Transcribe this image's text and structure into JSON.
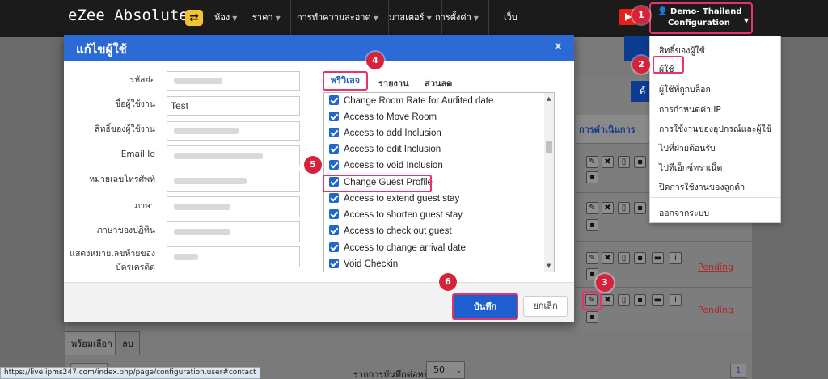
{
  "topbar": {
    "brand": "eZee Absolute",
    "nav": [
      {
        "label": "ห้อง",
        "caret": true
      },
      {
        "label": "ราคา",
        "caret": true
      },
      {
        "label": "การทำความสะอาด",
        "caret": true
      },
      {
        "label": "มาสเตอร์",
        "caret": true
      },
      {
        "label": "การตั้งค่า",
        "caret": true
      },
      {
        "label": "เว็บ",
        "caret": false
      }
    ],
    "user_line1": "Demo- Thailand",
    "user_line2": "Configuration"
  },
  "steps": [
    "1",
    "2",
    "3",
    "4",
    "5",
    "6"
  ],
  "dropdown": {
    "items": [
      "สิทธิ์ของผู้ใช้",
      "ผู้ใช้",
      "ผู้ใช้ที่ถูกบล็อก",
      "การกำหนดค่า IP",
      "การใช้งานของอุปกรณ์และผู้ใช้",
      "ไปที่ฝ่ายต้อนรับ",
      "ไปที่เอ็กซ์ทราเน็ต",
      "ปิดการใช้งานของลูกค้า"
    ],
    "logout": "ออกจากระบบ"
  },
  "background": {
    "actions_header": "การดำเนินการ",
    "blue_button_fragment": "ค้",
    "pending": "Pending",
    "bottom_tabs": {
      "select": "พร้อมเลือก",
      "delete": "ลบ"
    },
    "per_page_label": "รายการบันทึกต่อหน้า",
    "per_page_value": "50",
    "page_number": "1"
  },
  "modal": {
    "title": "แก้ไขผู้ใช้",
    "close": "x",
    "fields": [
      {
        "label": "รหัสย่อ",
        "value": ""
      },
      {
        "label": "ชื่อผู้ใช้งาน",
        "value": "Test"
      },
      {
        "label": "สิทธิ์ของผู้ใช้งาน",
        "value": ""
      },
      {
        "label": "Email Id",
        "value": ""
      },
      {
        "label": "หมายเลขโทรศัพท์",
        "value": ""
      },
      {
        "label": "ภาษา",
        "value": ""
      },
      {
        "label": "ภาษาของปฏิทิน",
        "value": ""
      },
      {
        "label_line1": "แสดงหมายเลขท้ายของ",
        "label_line2": "บัตรเครดิต",
        "value": ""
      }
    ],
    "tabs": [
      "พริวิเลจ",
      "รายงาน",
      "ส่วนลด"
    ],
    "permissions": [
      {
        "label": "Change Room Rate for Audited date",
        "checked": true
      },
      {
        "label": "Access to Move Room",
        "checked": true
      },
      {
        "label": "Access to add Inclusion",
        "checked": true
      },
      {
        "label": "Access to edit Inclusion",
        "checked": true
      },
      {
        "label": "Access to void Inclusion",
        "checked": true
      },
      {
        "label": "Change Guest Profile",
        "checked": true
      },
      {
        "label": "Access to extend guest stay",
        "checked": true
      },
      {
        "label": "Access to shorten guest stay",
        "checked": true
      },
      {
        "label": "Access to check out guest",
        "checked": true
      },
      {
        "label": "Access to change arrival date",
        "checked": true
      },
      {
        "label": "Void Checkin",
        "checked": true
      }
    ],
    "save": "บันทึก",
    "cancel": "ยกเลิก"
  },
  "statusbar": "https://live.ipms247.com/index.php/page/configuration.user#contact",
  "colors": {
    "accent": "#2b69d4",
    "highlight": "#e8336a",
    "topbar": "#1b1b1b",
    "step_badge": "#d6223a"
  }
}
